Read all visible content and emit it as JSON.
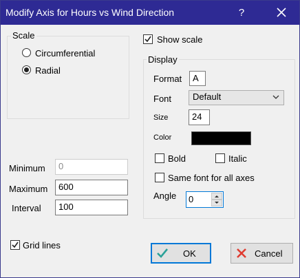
{
  "window": {
    "title": "Modify Axis for Hours vs Wind Direction",
    "help_label": "?",
    "close_icon": "close-icon"
  },
  "scale_group": {
    "label": "Scale",
    "options": [
      {
        "label": "Circumferential",
        "checked": false
      },
      {
        "label": "Radial",
        "checked": true
      }
    ]
  },
  "range": {
    "minimum_label": "Minimum",
    "minimum_value": "0",
    "maximum_label": "Maximum",
    "maximum_value": "600",
    "interval_label": "Interval",
    "interval_value": "100"
  },
  "grid_lines": {
    "label": "Grid lines",
    "checked": true
  },
  "show_scale": {
    "label": "Show scale",
    "checked": true
  },
  "display": {
    "label": "Display",
    "format_label": "Format",
    "format_value": "A",
    "font_label": "Font",
    "font_value": "Default",
    "size_label": "Size",
    "size_value": "24",
    "color_label": "Color",
    "color_value": "#000000",
    "bold_label": "Bold",
    "bold_checked": false,
    "italic_label": "Italic",
    "italic_checked": false,
    "same_font_label": "Same font for all axes",
    "same_font_checked": false,
    "angle_label": "Angle",
    "angle_value": "0"
  },
  "buttons": {
    "ok_label": "OK",
    "cancel_label": "Cancel"
  },
  "colors": {
    "titlebar": "#2e2a94",
    "accent": "#0078d7",
    "ok_icon": "#2aa198",
    "cancel_icon": "#e03c31"
  }
}
